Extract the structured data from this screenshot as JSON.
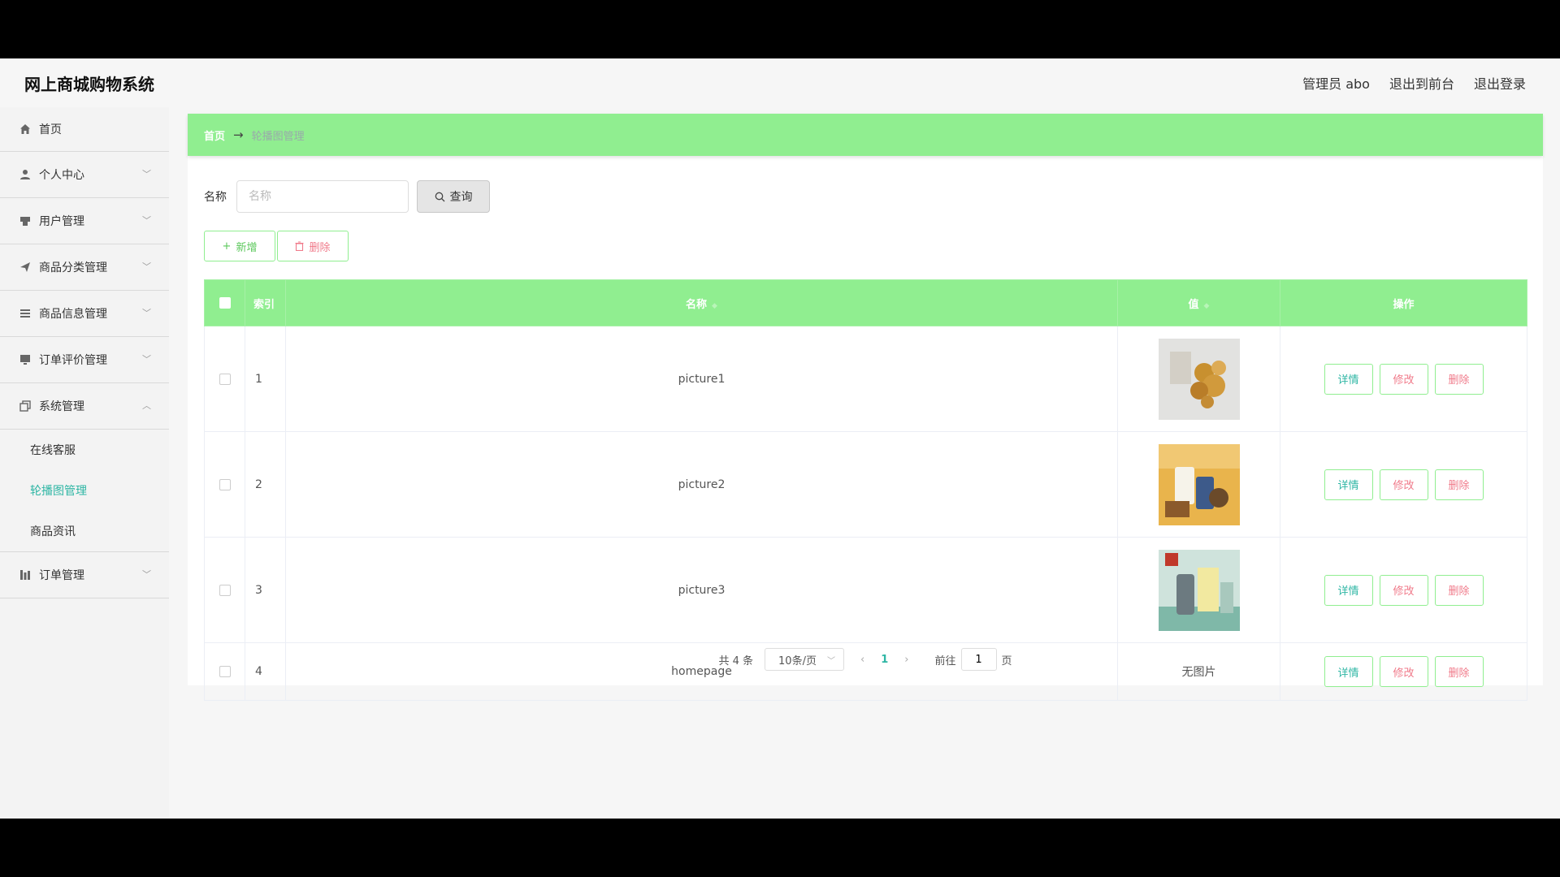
{
  "app": {
    "title": "网上商城购物系统"
  },
  "top_links": {
    "admin": "管理员 abo",
    "to_front": "退出到前台",
    "logout": "退出登录"
  },
  "sidebar": {
    "home": "首页",
    "personal": "个人中心",
    "users": "用户管理",
    "category": "商品分类管理",
    "goods": "商品信息管理",
    "review": "订单评价管理",
    "system": "系统管理",
    "system_sub": [
      "在线客服",
      "轮播图管理",
      "商品资讯"
    ],
    "orders": "订单管理"
  },
  "breadcrumb": {
    "home": "首页",
    "arrow": "→",
    "current": "轮播图管理"
  },
  "search": {
    "label": "名称",
    "placeholder": "名称",
    "button": "查询"
  },
  "actions": {
    "add": "新增",
    "delete": "删除"
  },
  "table": {
    "headers": {
      "index": "索引",
      "name": "名称",
      "value": "值",
      "ops": "操作"
    },
    "ops": {
      "detail": "详情",
      "edit": "修改",
      "delete": "删除"
    },
    "rows": [
      {
        "index": "1",
        "name": "picture1",
        "value": ""
      },
      {
        "index": "2",
        "name": "picture2",
        "value": ""
      },
      {
        "index": "3",
        "name": "picture3",
        "value": ""
      },
      {
        "index": "4",
        "name": "homepage",
        "value": "无图片"
      }
    ]
  },
  "pagination": {
    "total": "共 4 条",
    "page_size": "10条/页",
    "current": "1",
    "goto_prefix": "前往",
    "goto_value": "1",
    "goto_suffix": "页"
  }
}
